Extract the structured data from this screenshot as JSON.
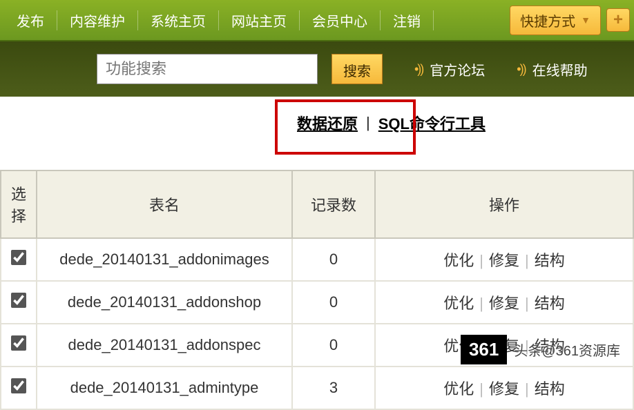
{
  "nav": {
    "items": [
      "发布",
      "内容维护",
      "系统主页",
      "网站主页",
      "会员中心",
      "注销"
    ],
    "quick": "快捷方式",
    "plus": "+"
  },
  "search": {
    "placeholder": "功能搜索",
    "btn": "搜索",
    "link_forum": "官方论坛",
    "link_help": "在线帮助"
  },
  "toolbar": {
    "restore": "数据还原",
    "sql": "SQL命令行工具",
    "sep": "|"
  },
  "table": {
    "headers": {
      "select": "选择",
      "name": "表名",
      "count": "记录数",
      "ops": "操作"
    },
    "op_labels": {
      "optimize": "优化",
      "repair": "修复",
      "structure": "结构",
      "sep": "|"
    },
    "rows": [
      {
        "name": "dede_20140131_addonimages",
        "count": "0"
      },
      {
        "name": "dede_20140131_addonshop",
        "count": "0"
      },
      {
        "name": "dede_20140131_addonspec",
        "count": "0"
      },
      {
        "name": "dede_20140131_admintype",
        "count": "3"
      }
    ]
  },
  "watermark": {
    "badge": "361",
    "text": "头条@361资源库"
  }
}
